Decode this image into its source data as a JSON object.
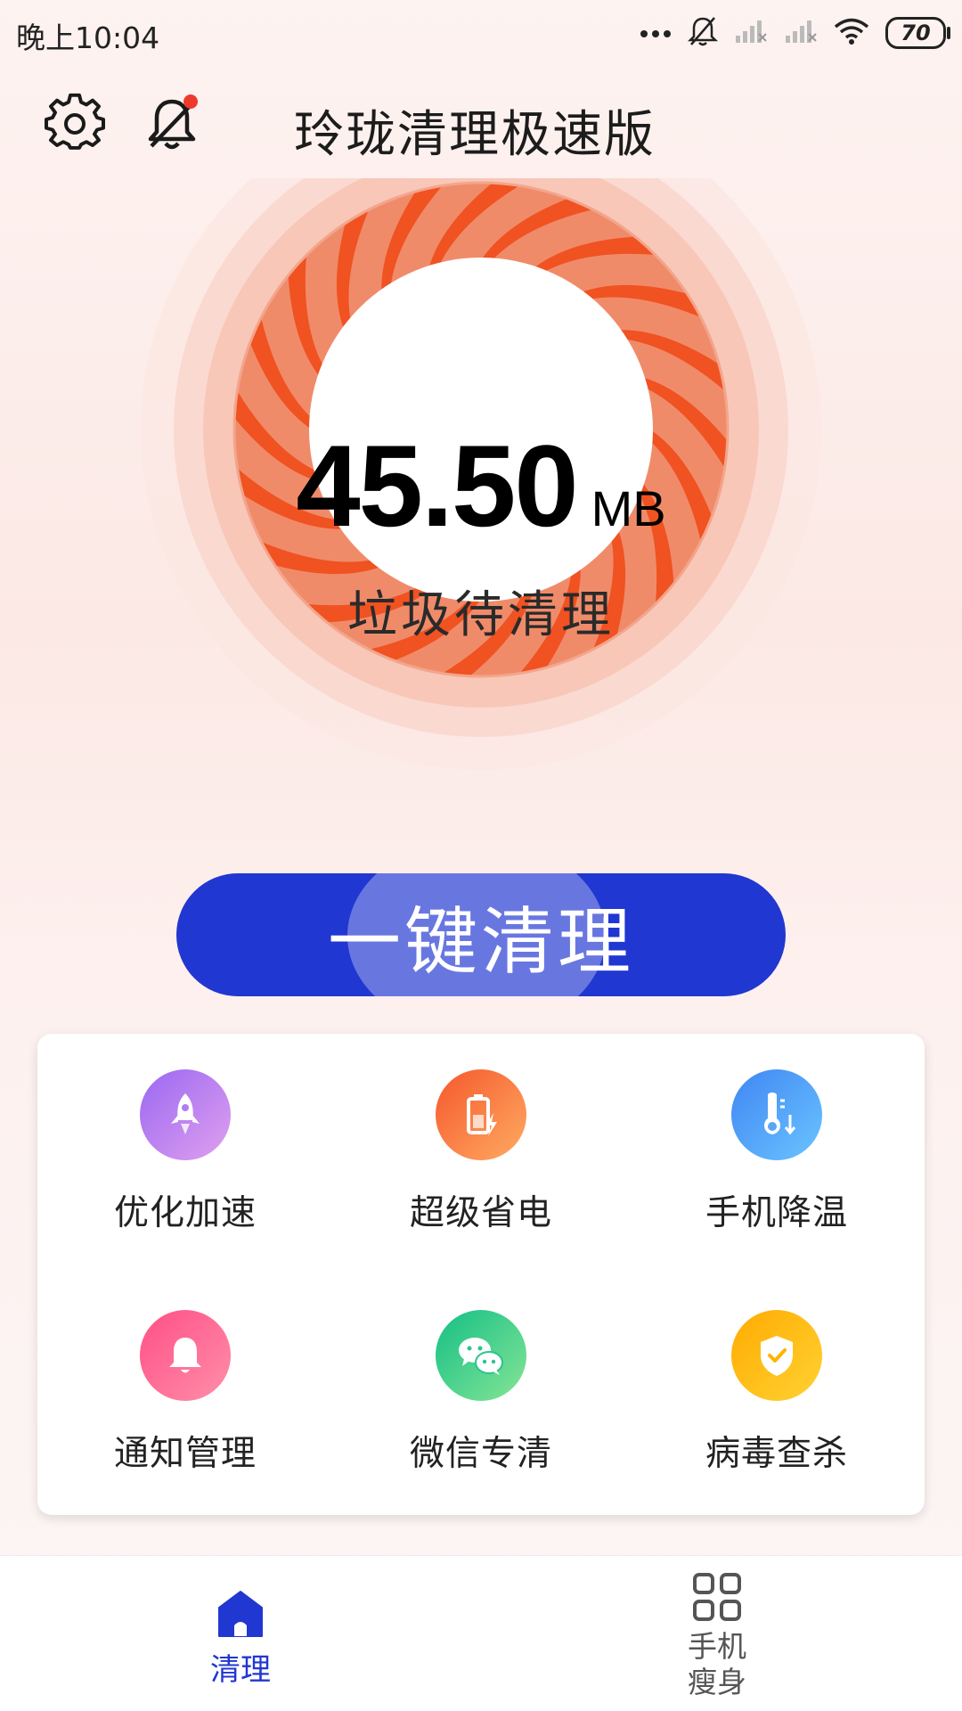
{
  "status_bar": {
    "time": "晚上10:04",
    "battery": "70"
  },
  "header": {
    "title": "玲珑清理极速版"
  },
  "gauge": {
    "junk_value": "45.50",
    "junk_unit": "MB",
    "junk_label": "垃圾待清理"
  },
  "clean_button": {
    "label": "一键清理"
  },
  "tools": [
    {
      "label": "优化加速",
      "icon": "rocket-icon",
      "color_from": "#a76cf0",
      "color_to": "#d792f0"
    },
    {
      "label": "超级省电",
      "icon": "battery-icon",
      "color_from": "#f66a3b",
      "color_to": "#ffa05a"
    },
    {
      "label": "手机降温",
      "icon": "thermometer-icon",
      "color_from": "#3f8cf3",
      "color_to": "#6fc0ff"
    },
    {
      "label": "通知管理",
      "icon": "bell-icon",
      "color_from": "#ff5c8c",
      "color_to": "#ff8aa8"
    },
    {
      "label": "微信专清",
      "icon": "wechat-icon",
      "color_from": "#1fc28a",
      "color_to": "#7ee28f"
    },
    {
      "label": "病毒查杀",
      "icon": "shield-icon",
      "color_from": "#ffb300",
      "color_to": "#ffcf2e"
    }
  ],
  "bottom_nav": {
    "home_label": "清理",
    "slim_label_line1": "手机",
    "slim_label_line2": "瘦身"
  },
  "colors": {
    "accent": "#2137d1",
    "gauge_orange": "#f08b6a",
    "gauge_stripe": "#f05221"
  }
}
